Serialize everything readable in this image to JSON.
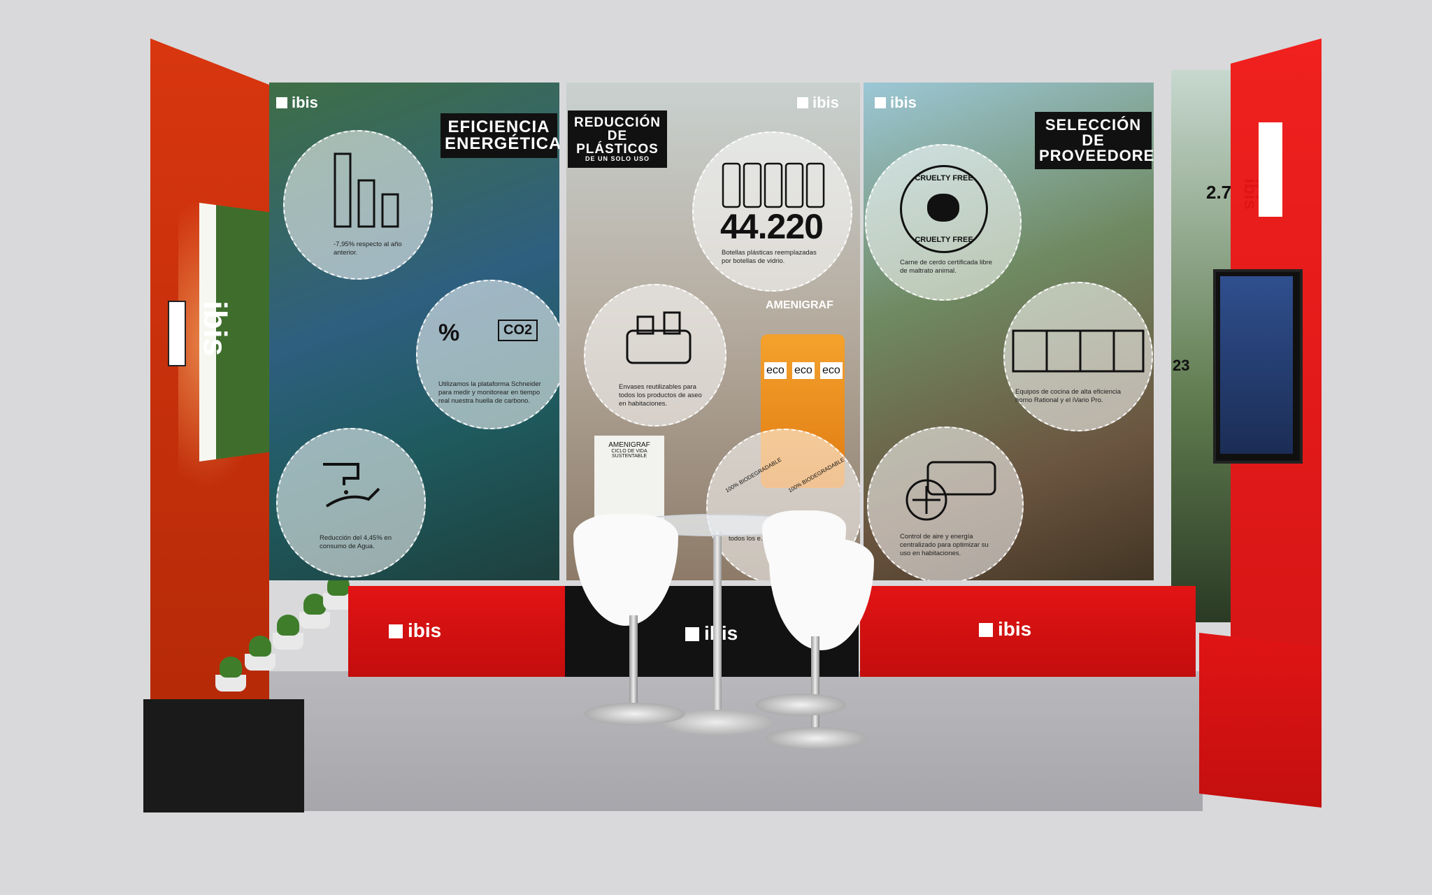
{
  "booth": {
    "brand": "ibis",
    "panels": [
      {
        "title_line1": "EFICIENCIA",
        "title_line2": "ENERGÉTICA",
        "captions": [
          "-7,95% respecto al año anterior.",
          "Utilizamos la plataforma Schneider para medir y monitorear en tiempo real nuestra huella de carbono.",
          "Reducción del 4,45% en consumo de Agua."
        ],
        "co2_label": "CO2",
        "percent_label": "%"
      },
      {
        "title_line1": "REDUCCIÓN DE",
        "title_line2": "PLÁSTICOS",
        "title_line3": "DE UN SOLO USO",
        "big_number": "44.220",
        "captions": [
          "Botellas plásticas reemplazadas por botellas de vidrio.",
          "Envases reutilizables para todos los productos de aseo en habitaciones.",
          "todos los e..."
        ],
        "bottle_brand": "AMENIGRAF",
        "eco_label": "eco",
        "card_title": "AMENIGRAF",
        "card_subtitle": "CICLO DE VIDA SUSTENTABLE",
        "biodegradable_label": "100% BIODEGRADABLE"
      },
      {
        "title_line1": "SELECCIÓN DE",
        "title_line2": "PROVEEDORES",
        "badge_top": "CRUELTY FREE",
        "badge_bottom": "CRUELTY FREE",
        "captions": [
          "Carne de cerdo certificada libre de maltrato animal.",
          "Equipos de cocina de alta eficiencia horno Rational y el iVario Pro.",
          "Control de aire y energía centralizado para optimizar su uso en habitaciones."
        ]
      }
    ],
    "side_panel_number": "2.70",
    "side_panel_percent": "23"
  }
}
